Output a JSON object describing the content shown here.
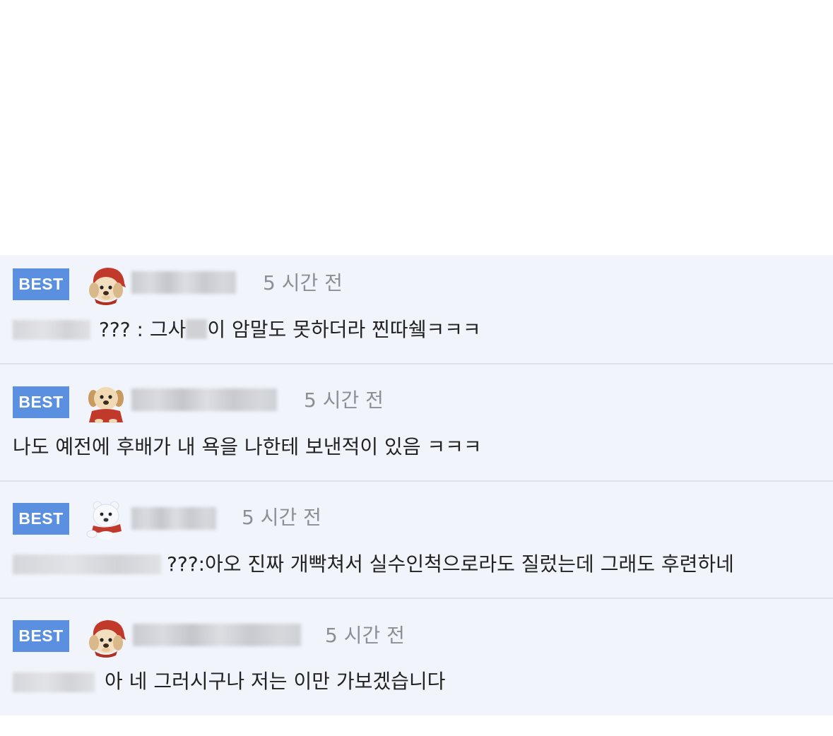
{
  "comments": [
    {
      "badge": "BEST",
      "avatar_icon": "puppy-red-hood-icon",
      "time": "5 시간 전",
      "text_before": "??? : 그사",
      "text_after": "이 암말도 못하더라 찐따쉨ㅋㅋㅋ"
    },
    {
      "badge": "BEST",
      "avatar_icon": "puppy-red-scarf-icon",
      "time": "5 시간 전",
      "text": "나도 예전에 후배가 내 욕을 나한테 보낸적이 있음 ㅋㅋㅋ"
    },
    {
      "badge": "BEST",
      "avatar_icon": "polar-bear-icon",
      "time": "5 시간 전",
      "text": "???:아오 진짜 개빡쳐서 실수인척으로라도 질렀는데 그래도 후련하네"
    },
    {
      "badge": "BEST",
      "avatar_icon": "puppy-red-hood-icon",
      "time": "5 시간 전",
      "text": "아 네 그러시구나 저는 이만 가보겠습니다"
    }
  ]
}
